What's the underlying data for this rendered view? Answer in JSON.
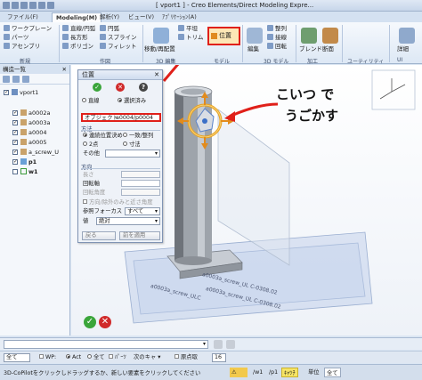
{
  "window": {
    "title": "[ vport1 ] - Creo Elements/Direct Modeling Expre..."
  },
  "tabs": [
    {
      "label": "ファイル(F)"
    },
    {
      "label": "Modeling(M)"
    },
    {
      "label": "解析(Y)"
    },
    {
      "label": "ビュー(V)"
    },
    {
      "label": "ｱﾌﾟﾘｹｰｼｮﾝ(A)"
    }
  ],
  "ribbon": {
    "items": {
      "workplane": "ワークプレーン",
      "parts": "パーツ",
      "assembly": "アセンブリ",
      "line_circle": "直線/円弧",
      "rect": "長方形",
      "polygon": "ポリゴン",
      "circle": "円弧",
      "spline": "スプライン",
      "fillet": "フィレット",
      "move_copy": "移動/再配置",
      "plane": "平坦",
      "trim": "トリム",
      "position": "位置",
      "edit": "編集",
      "array": "整列",
      "fillet2": "接線",
      "rotate": "回転",
      "blend": "ブレンド",
      "section": "断面",
      "detail": "詳細"
    },
    "groups": {
      "new": "新規",
      "create": "作図",
      "3d_model": "3D 編集",
      "model": "モデル",
      "3d_model2": "3D モデル",
      "machining": "加工",
      "utility": "ユーティリティ",
      "ui": "UI"
    }
  },
  "tree": {
    "header": "構造一覧",
    "items": [
      {
        "label": "vport1",
        "checked": true
      },
      {
        "label": "a0002a",
        "checked": true
      },
      {
        "label": "a0003a",
        "checked": true
      },
      {
        "label": "a0004",
        "checked": true
      },
      {
        "label": "a0005",
        "checked": true
      },
      {
        "label": "a_screw_U",
        "checked": true
      },
      {
        "label": "p1",
        "checked": true
      },
      {
        "label": "w1",
        "checked": false
      }
    ]
  },
  "dialog": {
    "title": "位置",
    "mode_options": [
      "直線",
      "選択済み"
    ],
    "object_label": "オブジェクト",
    "object_value": "a0004/p0004",
    "direction_section": "方法",
    "direction_options": [
      "連続位置決め",
      "一致/整列",
      "2点",
      "寸法"
    ],
    "other_label": "その他",
    "orientation_section": "方向",
    "length_label": "長さ",
    "rotation_axis_label": "回転軸",
    "rotation_angle_label": "回転角度",
    "align_check_label": "方向/除外のみ",
    "consider_label": "と近さ角度",
    "reference_label": "参照フォーカス",
    "reference_value": "すべて",
    "base_label": "値",
    "base_value": "絶対",
    "back_button": "戻る",
    "next_button": "前を適用"
  },
  "annotation": {
    "line1": "こいつ で",
    "line2": "うごかす"
  },
  "part_labels": [
    "a0003a_screw_UL C-0308.02",
    "a0003a_screw_UL C-0308.02",
    "a0003a_screw_ULC"
  ],
  "filter_bar": {
    "select1": "全て",
    "wp_label": "WP:",
    "act_label": "Act",
    "all_label": "全て",
    "part_label": "ﾊﾟｰﾂ",
    "next_label": "次のキャ",
    "origin_label": "原点取",
    "count": "16"
  },
  "status": {
    "message": "3D-CoPilotをクリックしドラッグするか、新しい要素をクリックしてください",
    "page": "/w1",
    "page2": "/p1",
    "dims": "ｷｬﾂﾁ",
    "unit_label": "単位",
    "unit_value": "全て"
  },
  "colors": {
    "accent_red": "#e0201a",
    "ok_green": "#3aa53a",
    "cancel_red": "#d02a2a",
    "ribbon_blue": "#dbe6f3"
  }
}
